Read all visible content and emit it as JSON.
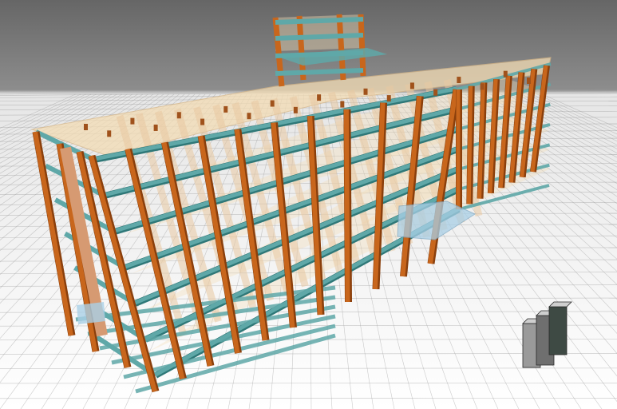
{
  "viewport": {
    "background_top": "#6a6a6a",
    "background_bottom": "#ffffff",
    "grid_color": "#9a9a9a"
  },
  "model": {
    "column_color": "#c8661c",
    "column_edge": "#8a3f0c",
    "beam_color": "#5fa8a8",
    "beam_edge": "#2f7878",
    "slab_color": "#f3dcb4",
    "ghost_column_color": "#e9c9a2",
    "glass_color": "#a9cfe6"
  },
  "nav_widget": {
    "icon": "view-cube-icon",
    "colors": [
      "#9a9a9a",
      "#6f6f6f",
      "#3e4a44"
    ]
  }
}
